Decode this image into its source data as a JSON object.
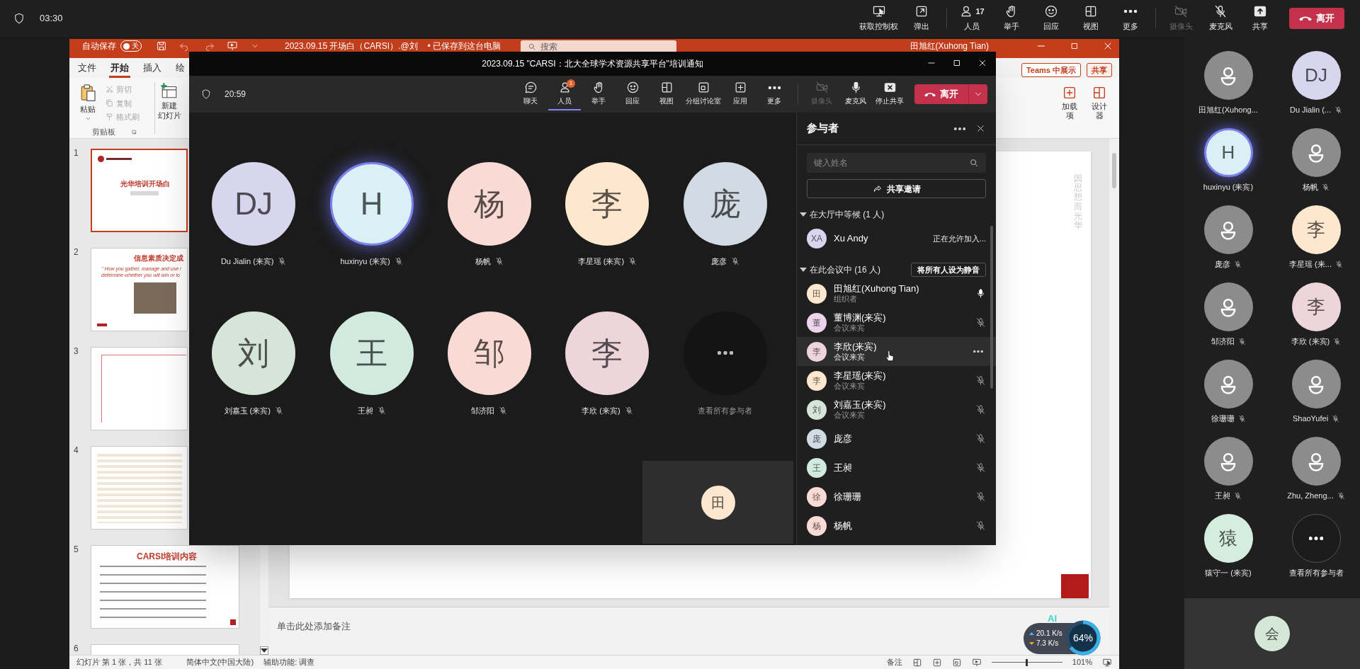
{
  "meeting_bar": {
    "timer": "03:30",
    "buttons": [
      {
        "label": "获取控制权",
        "disabled": false
      },
      {
        "label": "弹出",
        "disabled": false
      },
      {
        "label": "人员",
        "count": "17",
        "disabled": false
      },
      {
        "label": "举手",
        "disabled": false
      },
      {
        "label": "回应",
        "disabled": false
      },
      {
        "label": "视图",
        "disabled": false
      },
      {
        "label": "更多",
        "disabled": false
      },
      {
        "label": "摄像头",
        "disabled": true
      },
      {
        "label": "麦克风",
        "disabled": false
      },
      {
        "label": "共享",
        "disabled": false
      }
    ],
    "leave_button": "离开"
  },
  "powerpoint": {
    "title_bar": {
      "autosave": {
        "label": "自动保存",
        "toggle": "关",
        "on": false
      },
      "file_name": "2023.09.15 开场白（CARSI）.@刘",
      "save_status": "• 已保存到这台电脑",
      "search_placeholder": "搜索",
      "user": "田旭红(Xuhong Tian)"
    },
    "ribbon_tabs": [
      {
        "label": "文件",
        "selected": false
      },
      {
        "label": "开始",
        "selected": true
      },
      {
        "label": "插入",
        "selected": false
      },
      {
        "label": "绘",
        "selected": false
      }
    ],
    "ribbon_right_buttons": [
      "Teams 中展示",
      "共享"
    ],
    "clipboard": {
      "paste": "粘贴",
      "items": [
        {
          "label": "剪切",
          "disabled": true
        },
        {
          "label": "复制",
          "disabled": true
        },
        {
          "label": "格式刷",
          "disabled": true
        }
      ],
      "group_label": "剪贴板"
    },
    "new_slide": {
      "line1": "新建",
      "line2": "幻灯片"
    },
    "ribbon_right_items": [
      "加载项",
      "设计器"
    ],
    "slides": [
      {
        "number": "1",
        "selected": true,
        "kind": "title",
        "title": "光华培训开场白"
      },
      {
        "number": "2",
        "selected": false,
        "kind": "quote",
        "title": "信息素质决定成",
        "quote": [
          "\" How you gather, manage and use i",
          "determine whether you will win or lo"
        ]
      },
      {
        "number": "3",
        "selected": false,
        "kind": "tree"
      },
      {
        "number": "4",
        "selected": false,
        "kind": "table"
      },
      {
        "number": "5",
        "selected": false,
        "kind": "list",
        "title": "CARSI培训内容"
      },
      {
        "number": "6",
        "selected": false,
        "kind": "blank"
      }
    ],
    "slide_vertical_text": "因思想而光华",
    "notes_placeholder": "单击此处添加备注",
    "status_bar": {
      "slide_count": "幻灯片 第 1 张，共 11 张",
      "language": "简体中文(中国大陆)",
      "accessibility": "辅助功能: 调查",
      "notes": "备注",
      "zoom_slider": {
        "level": 0.48
      },
      "zoom": "101%"
    }
  },
  "network_widget": {
    "ai": "AI",
    "upload": "20.1 K/s",
    "download": "7.3 K/s",
    "level": 0.64,
    "percent": "64%"
  },
  "teams_window": {
    "title": "2023.09.15 \"CARSI：北大全球学术资源共享平台\"培训通知",
    "timer": "20:59",
    "toolbar": [
      {
        "label": "聊天",
        "selected": false,
        "disabled": false
      },
      {
        "label": "人员",
        "badge": "1",
        "selected": true,
        "disabled": false
      },
      {
        "label": "举手",
        "selected": false,
        "disabled": false
      },
      {
        "label": "回应",
        "selected": false,
        "disabled": false
      },
      {
        "label": "视图",
        "selected": false,
        "disabled": false
      },
      {
        "label": "分组讨论室",
        "selected": false,
        "disabled": false
      },
      {
        "label": "应用",
        "selected": false,
        "disabled": false
      },
      {
        "label": "更多",
        "selected": false,
        "disabled": false
      },
      {
        "label": "摄像头",
        "selected": false,
        "disabled": true
      },
      {
        "label": "麦克风",
        "selected": false,
        "disabled": false
      },
      {
        "label": "停止共享",
        "selected": false,
        "disabled": false
      }
    ],
    "leave_button": "离开",
    "tiles": [
      {
        "kind": "initials",
        "initials": "DJ",
        "name": "Du Jialin (来宾)",
        "color": "#d8d5ee",
        "muted": true,
        "speaking": false
      },
      {
        "kind": "initials",
        "initials": "H",
        "name": "huxinyu (来宾)",
        "color": "#d9f0f4",
        "muted": true,
        "speaking": true
      },
      {
        "kind": "initials",
        "initials": "杨",
        "name": "杨帆",
        "color": "#f9dad4",
        "muted": true,
        "speaking": false
      },
      {
        "kind": "initials",
        "initials": "李",
        "name": "李星瑶 (来宾)",
        "color": "#fde8cf",
        "muted": true,
        "speaking": false
      },
      {
        "kind": "initials",
        "initials": "庞",
        "name": "庞彦",
        "color": "#d2dbe4",
        "muted": true,
        "speaking": false
      },
      {
        "kind": "initials",
        "initials": "刘",
        "name": "刘嘉玉 (来宾)",
        "color": "#d5e5d7",
        "muted": true,
        "speaking": false
      },
      {
        "kind": "initials",
        "initials": "王",
        "name": "王昶",
        "color": "#d0eadf",
        "muted": true,
        "speaking": false
      },
      {
        "kind": "initials",
        "initials": "邹",
        "name": "邹济阳",
        "color": "#f9dad4",
        "muted": true,
        "speaking": false
      },
      {
        "kind": "initials",
        "initials": "李",
        "name": "李欣 (来宾)",
        "color": "#eed5dc",
        "muted": true,
        "speaking": false
      },
      {
        "kind": "more",
        "name": "查看所有参与者"
      }
    ],
    "self_view": {
      "initials": "田",
      "color": "#fde8cf"
    },
    "panel": {
      "title": "参与者",
      "search_placeholder": "键入姓名",
      "share_invite": "共享邀请",
      "lobby": {
        "label": "在大厅中等候 (1 人)",
        "expanded": true,
        "people": [
          {
            "initials": "XA",
            "name": "Xu Andy",
            "color": "#d8d5ee",
            "status": "正在允许加入..."
          }
        ]
      },
      "in_meeting": {
        "label": "在此会议中 (16 人)",
        "expanded": true,
        "mute_all": "将所有人设为静音",
        "people": [
          {
            "initials": "田",
            "name": "田旭红(Xuhong Tian)",
            "role": "组织者",
            "color": "#fde8cf",
            "muted": false,
            "hovered": false
          },
          {
            "initials": "董",
            "name": "董博渊(来宾)",
            "role": "会议来宾",
            "color": "#ecd5ec",
            "muted": true,
            "hovered": false
          },
          {
            "initials": "李",
            "name": "李欣(来宾)",
            "role": "会议来宾",
            "color": "#eed5dc",
            "hovered": true
          },
          {
            "initials": "李",
            "name": "李星瑶(来宾)",
            "role": "会议来宾",
            "color": "#fde8cf",
            "muted": true,
            "hovered": false
          },
          {
            "initials": "刘",
            "name": "刘嘉玉(来宾)",
            "role": "会议来宾",
            "color": "#d5e5d7",
            "muted": true,
            "hovered": false
          },
          {
            "initials": "庞",
            "name": "庞彦",
            "color": "#d2dbe4",
            "muted": true,
            "hovered": false
          },
          {
            "initials": "王",
            "name": "王昶",
            "color": "#d0eadf",
            "muted": true,
            "hovered": false
          },
          {
            "initials": "徐",
            "name": "徐珊珊",
            "color": "#f9dad4",
            "muted": true,
            "hovered": false
          },
          {
            "initials": "杨",
            "name": "杨帆",
            "color": "#f9dad4",
            "muted": true,
            "hovered": false
          }
        ]
      }
    }
  },
  "gallery": [
    {
      "kind": "generic",
      "name": "田旭红(Xuhong...",
      "muted": false,
      "speaking": false
    },
    {
      "kind": "initials",
      "initials": "DJ",
      "name": "Du Jialin (...",
      "color": "#d8d5ee",
      "muted": true,
      "speaking": false
    },
    {
      "kind": "initials",
      "initials": "H",
      "name": "huxinyu (来宾)",
      "color": "#d9f0f4",
      "muted": false,
      "speaking": true
    },
    {
      "kind": "generic",
      "name": "杨帆",
      "muted": true,
      "speaking": false
    },
    {
      "kind": "generic",
      "name": "庞彦",
      "muted": true,
      "speaking": false
    },
    {
      "kind": "initials",
      "initials": "李",
      "name": "李星瑶 (来...",
      "color": "#fde8cf",
      "muted": true,
      "speaking": false
    },
    {
      "kind": "generic",
      "name": "邹济阳",
      "muted": true,
      "speaking": false
    },
    {
      "kind": "initials",
      "initials": "李",
      "name": "李欣 (来宾)",
      "color": "#eed5dc",
      "muted": true,
      "speaking": false
    },
    {
      "kind": "generic",
      "name": "徐珊珊",
      "muted": true,
      "speaking": false
    },
    {
      "kind": "generic",
      "name": "ShaoYufei",
      "muted": true,
      "speaking": false
    },
    {
      "kind": "generic",
      "name": "王昶",
      "muted": true,
      "speaking": false
    },
    {
      "kind": "generic",
      "name": "Zhu, Zheng...",
      "muted": true,
      "speaking": false
    },
    {
      "kind": "initials",
      "initials": "猿",
      "name": "猿守一 (来宾)",
      "color": "#d5eddc",
      "speaking": false
    },
    {
      "kind": "more",
      "name": "查看所有参与者"
    }
  ],
  "gallery_self_view": {
    "initials": "会",
    "color": "#d5e8d8"
  }
}
